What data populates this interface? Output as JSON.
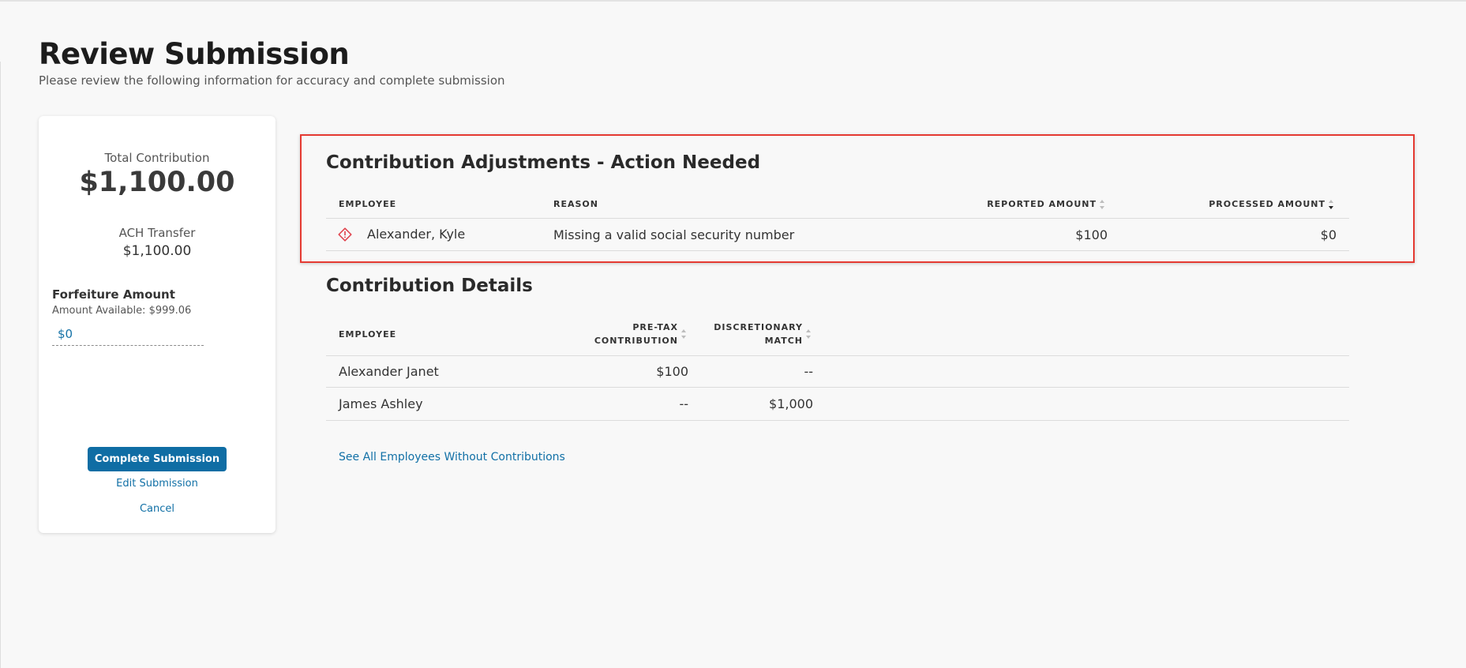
{
  "page": {
    "title": "Review Submission",
    "subtitle": "Please review the following information for accuracy and complete submission"
  },
  "summary": {
    "total_label": "Total Contribution",
    "total_value": "$1,100.00",
    "ach_label": "ACH Transfer",
    "ach_value": "$1,100.00",
    "forfeiture_title": "Forfeiture Amount",
    "forfeiture_available": "Amount Available: $999.06",
    "forfeiture_value": "$0",
    "complete_label": "Complete Submission",
    "edit_label": "Edit Submission",
    "cancel_label": "Cancel"
  },
  "adjustments": {
    "title": "Contribution Adjustments - Action Needed",
    "headers": {
      "employee": "EMPLOYEE",
      "reason": "REASON",
      "reported": "REPORTED AMOUNT",
      "processed": "PROCESSED AMOUNT"
    },
    "rows": [
      {
        "icon": "warning-diamond-icon",
        "employee": "Alexander, Kyle",
        "reason": "Missing a valid social security number",
        "reported": "$100",
        "processed": "$0"
      }
    ]
  },
  "details": {
    "title": "Contribution Details",
    "headers": {
      "employee": "EMPLOYEE",
      "pretax_line1": "PRE-TAX",
      "pretax_line2": "CONTRIBUTION",
      "match_line1": "DISCRETIONARY",
      "match_line2": "MATCH"
    },
    "rows": [
      {
        "employee": "Alexander Janet",
        "pretax": "$100",
        "match": "--"
      },
      {
        "employee": "James Ashley",
        "pretax": "--",
        "match": "$1,000"
      }
    ],
    "see_all_label": "See All Employees Without Contributions"
  },
  "colors": {
    "primary": "#0f6da4",
    "link": "#1170a6",
    "highlight": "#e53a32",
    "warning": "#e0404a"
  }
}
